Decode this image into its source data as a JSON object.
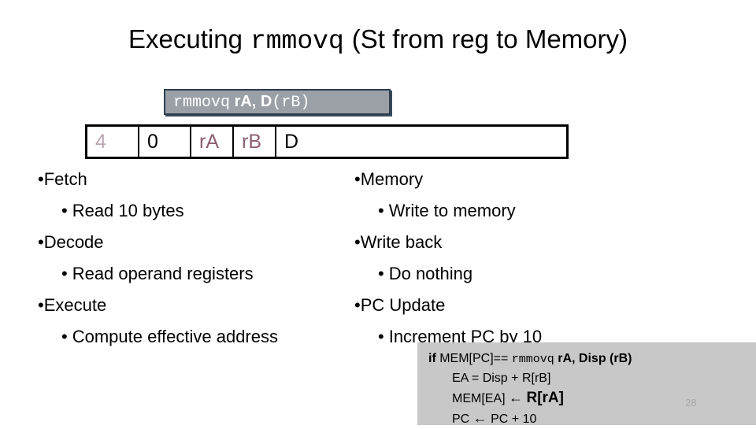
{
  "slide": {
    "title": {
      "prefix": "Executing",
      "mnemonic": "rmmovq",
      "suffix": "(St from reg to Memory)"
    },
    "page_number": "28"
  },
  "syntax_box": {
    "mnemonic": "rmmovq",
    "operands_a": " rA, D",
    "operands_b": "(rB)",
    "background_color": "#9aa0a6",
    "text_color": "#ffffff",
    "border_color": "#2c3e50"
  },
  "encoding_table": {
    "cells": [
      {
        "label": "4",
        "name": "icode",
        "color": "#b9a6b4"
      },
      {
        "label": "0",
        "name": "ifun",
        "color": "#000000"
      },
      {
        "label": "rA",
        "name": "ra",
        "color": "#8b5f74"
      },
      {
        "label": "rB",
        "name": "rb",
        "color": "#8b5f74"
      },
      {
        "label": "D",
        "name": "displacement",
        "color": "#000000"
      }
    ]
  },
  "stages": {
    "left": [
      {
        "level": 1,
        "bullet": "•",
        "text": "Fetch"
      },
      {
        "level": 2,
        "bullet": "•",
        "text": "Read 10 bytes"
      },
      {
        "level": 1,
        "bullet": "•",
        "text": "Decode"
      },
      {
        "level": 2,
        "bullet": "•",
        "text": "Read operand registers"
      },
      {
        "level": 1,
        "bullet": "•",
        "text": "Execute"
      },
      {
        "level": 2,
        "bullet": "•",
        "text": "Compute effective address"
      }
    ],
    "right": [
      {
        "level": 1,
        "bullet": "•",
        "text": "Memory"
      },
      {
        "level": 2,
        "bullet": "•",
        "text": "Write to memory"
      },
      {
        "level": 1,
        "bullet": "•",
        "text": "Write back"
      },
      {
        "level": 2,
        "bullet": "•",
        "text": "Do nothing"
      },
      {
        "level": 1,
        "bullet": "•",
        "text": "PC Update"
      },
      {
        "level": 2,
        "bullet": "•",
        "text": "Increment PC by 10"
      }
    ]
  },
  "semantics": {
    "background_color": "#c8c8c8",
    "line1_if": "if ",
    "line1_cond": "MEM[PC]== ",
    "line1_mnemonic": "rmmovq",
    "line1_operands": " rA, Disp (rB)",
    "line2": "EA = Disp + R[rB]",
    "line3_lhs": "MEM[EA] ",
    "line3_arrow": "←",
    "line3_rhs": "R[rA]",
    "line4_lhs": "PC ",
    "line4_arrow": "←",
    "line4_rhs": " PC + 10"
  }
}
